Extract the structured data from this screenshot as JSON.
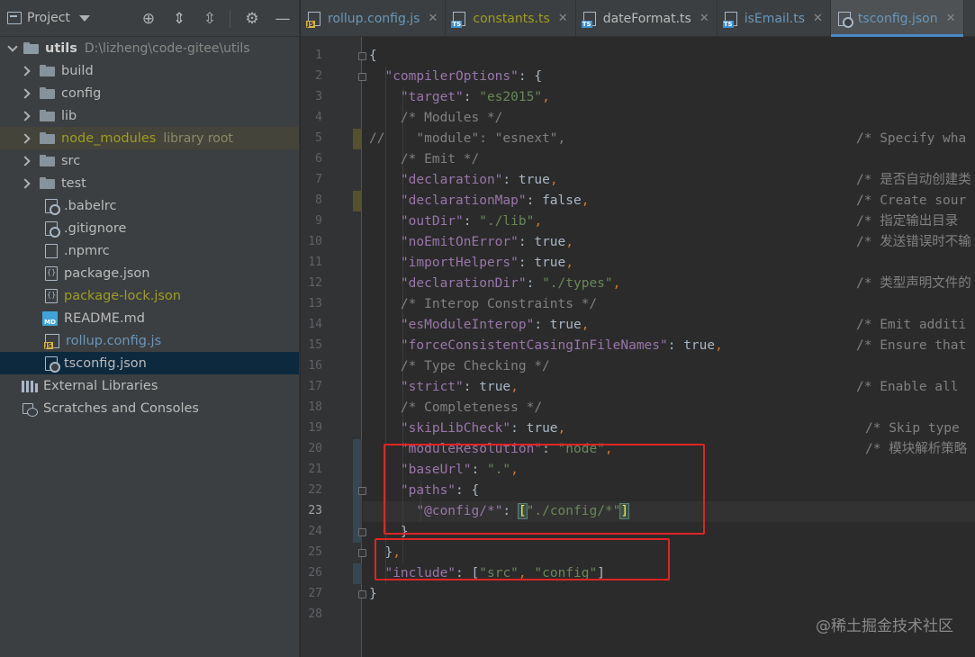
{
  "project_panel": {
    "title": "Project",
    "tree": [
      {
        "label": "utils",
        "path": "D:\\lizheng\\code-gitee\\utils",
        "kind": "root"
      },
      {
        "label": "build",
        "kind": "folder"
      },
      {
        "label": "config",
        "kind": "folder"
      },
      {
        "label": "lib",
        "kind": "folder"
      },
      {
        "label": "node_modules",
        "suffix": "library root",
        "kind": "folder-lib"
      },
      {
        "label": "src",
        "kind": "folder"
      },
      {
        "label": "test",
        "kind": "folder"
      },
      {
        "label": ".babelrc",
        "kind": "cfg"
      },
      {
        "label": ".gitignore",
        "kind": "cfg"
      },
      {
        "label": ".npmrc",
        "kind": "file"
      },
      {
        "label": "package.json",
        "kind": "json"
      },
      {
        "label": "package-lock.json",
        "kind": "json"
      },
      {
        "label": "README.md",
        "kind": "md"
      },
      {
        "label": "rollup.config.js",
        "kind": "js"
      },
      {
        "label": "tsconfig.json",
        "kind": "cfg"
      },
      {
        "label": "External Libraries",
        "kind": "libs"
      },
      {
        "label": "Scratches and Consoles",
        "kind": "scratch"
      }
    ]
  },
  "tabs": [
    {
      "label": "rollup.config.js",
      "badge": "JS"
    },
    {
      "label": "constants.ts",
      "badge": "TS"
    },
    {
      "label": "dateFormat.ts",
      "badge": "TS"
    },
    {
      "label": "isEmail.ts",
      "badge": "TS"
    },
    {
      "label": "tsconfig.json",
      "badge": ""
    }
  ],
  "editor": {
    "current_line": 23,
    "line_numbers": [
      "1",
      "2",
      "3",
      "4",
      "5",
      "6",
      "7",
      "8",
      "9",
      "10",
      "11",
      "12",
      "13",
      "14",
      "15",
      "16",
      "17",
      "18",
      "19",
      "20",
      "21",
      "22",
      "23",
      "24",
      "25",
      "26",
      "27",
      "28"
    ],
    "lines": [
      "{",
      "  \"compilerOptions\": {",
      "    \"target\": \"es2015\",",
      "    /* Modules */",
      "//    \"module\": \"esnext\",",
      "    /* Emit */",
      "    \"declaration\": true,",
      "    \"declarationMap\": false,",
      "    \"outDir\": \"./lib\",",
      "    \"noEmitOnError\": true,",
      "    \"importHelpers\": true,",
      "    \"declarationDir\": \"./types\",",
      "    /* Interop Constraints */",
      "    \"esModuleInterop\": true,",
      "    \"forceConsistentCasingInFileNames\": true,",
      "    /* Type Checking */",
      "    \"strict\": true,",
      "    /* Completeness */",
      "    \"skipLibCheck\": true,",
      "    \"moduleResolution\": \"node\",",
      "    \"baseUrl\": \".\",",
      "    \"paths\": {",
      "      \"@config/*\": [\"./config/*\"]",
      "    }",
      "  },",
      "  \"include\": [\"src\", \"config\"]",
      "}",
      ""
    ],
    "comments": {
      "5": "/* Specify wha",
      "7": "/* 是否自动创建类",
      "8": "/* Create sour",
      "9": "/* 指定输出目录",
      "10": "/* 发送错误时不输",
      "12": "/* 类型声明文件的",
      "14": "/* Emit additi",
      "15": "/* Ensure that",
      "17": "/* Enable all",
      "19": "/* Skip type",
      "20": "/* 模块解析策略"
    }
  },
  "watermark": "@稀土掘金技术社区",
  "colors": {
    "key": "#9876aa",
    "string": "#6a8759",
    "keyword": "#cc7832",
    "comment": "#808080",
    "highlight_box": "#e02424"
  }
}
